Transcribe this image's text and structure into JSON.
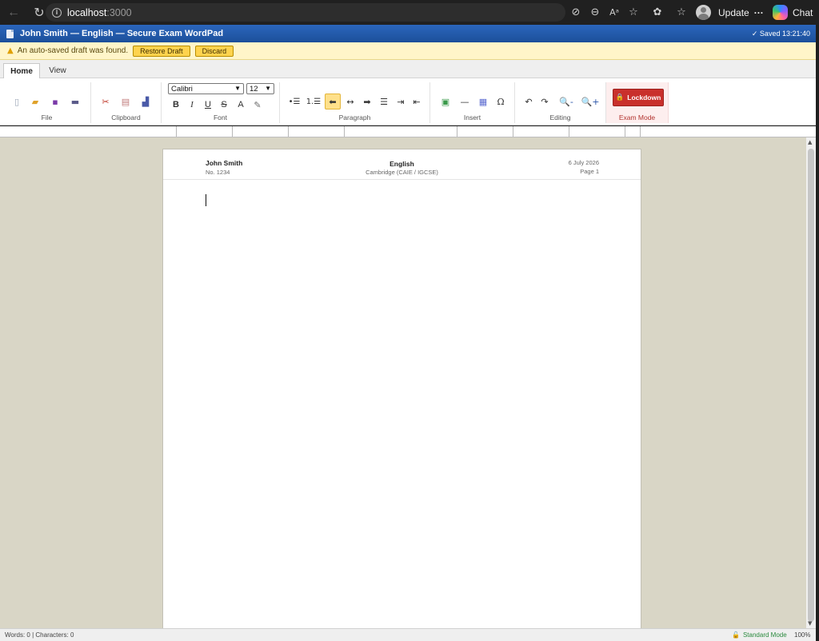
{
  "browser": {
    "url_host": "localhost",
    "url_port": ":3000",
    "update_label": "Update",
    "chat_label": "Chat"
  },
  "app": {
    "title": "John Smith — English — Secure Exam WordPad",
    "saved_status": "✓ Saved 13:21:40"
  },
  "notification": {
    "message": "An auto-saved draft was found.",
    "restore_label": "Restore Draft",
    "discard_label": "Discard"
  },
  "ribbon": {
    "tabs": [
      "Home",
      "View"
    ],
    "groups": {
      "file": "File",
      "clipboard": "Clipboard",
      "font": "Font",
      "paragraph": "Paragraph",
      "insert": "Insert",
      "editing": "Editing",
      "exam_mode": "Exam Mode"
    },
    "font_family": "Calibri",
    "font_size": "12",
    "lockdown_label": "Lockdown"
  },
  "document": {
    "student_name": "John Smith",
    "candidate_no": "No. 1234",
    "subject": "English",
    "board": "Cambridge (CAIE / IGCSE)",
    "date": "6 July 2026",
    "page": "Page 1"
  },
  "status": {
    "counts": "Words: 0 | Characters: 0",
    "mode": "Standard Mode",
    "zoom": "100%"
  },
  "colors": {
    "title_bar": "#2157a8",
    "notify_bg": "#fff5c9",
    "lockdown": "#c9302c",
    "workspace": "#d9d6c6"
  }
}
